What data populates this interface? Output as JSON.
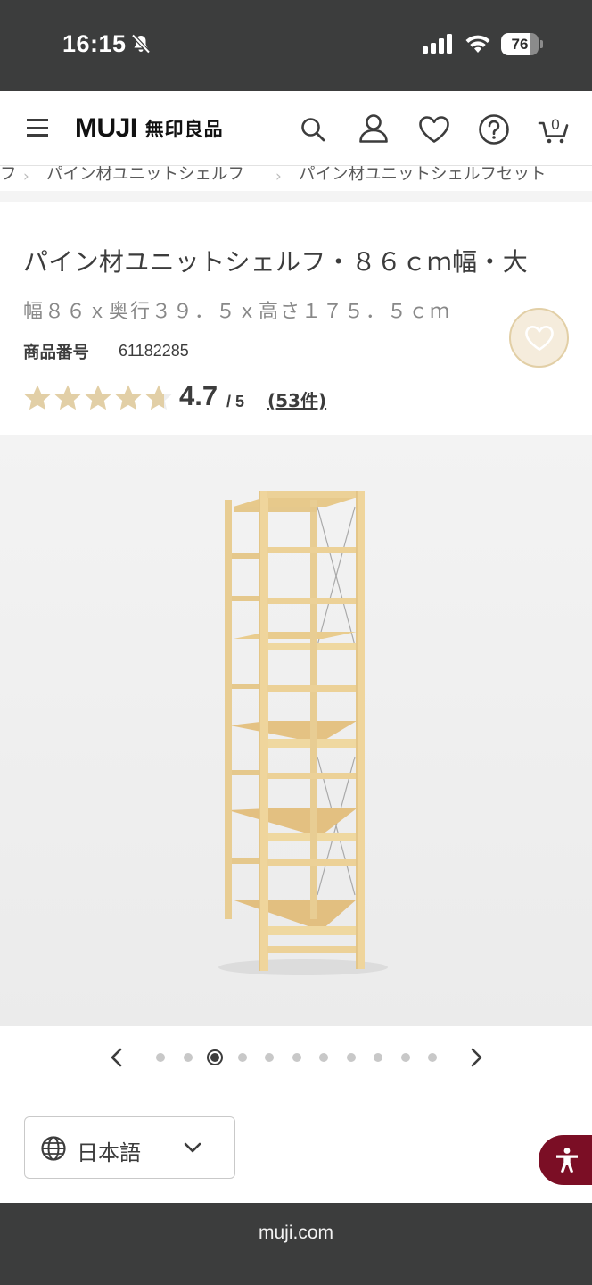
{
  "status_bar": {
    "time": "16:15",
    "battery": "76",
    "battery_level": 0.76
  },
  "header": {
    "logo_latin": "MUJI",
    "logo_jp": "無印良品",
    "cart_count": "0",
    "icons": [
      "menu-icon",
      "search-icon",
      "account-icon",
      "favorites-icon",
      "help-icon",
      "cart-icon"
    ]
  },
  "breadcrumb": {
    "items": [
      "フ",
      "パイン材ユニットシェルフ",
      "パイン材ユニットシェルフセット"
    ]
  },
  "product": {
    "title": "パイン材ユニットシェルフ・８６ｃｍ幅・大",
    "dimensions": "幅８６ｘ奥行３９．５ｘ高さ１７５．５ｃｍ",
    "code_label": "商品番号",
    "code_value": "61182285",
    "rating": "4.7",
    "rating_max": "/ 5",
    "rating_value": 4.7,
    "review_count": "(53件)"
  },
  "gallery": {
    "image_alt": "pine-unit-shelf-photo",
    "total_slides": 11,
    "active_slide": 3
  },
  "language": {
    "selected": "日本語"
  },
  "footer": {
    "url": "muji.com"
  },
  "colors": {
    "dark_bar": "#3c3d3d",
    "star": "#e2cfa6",
    "accessibility": "#7b0e25",
    "pine": "#ecd59d"
  }
}
